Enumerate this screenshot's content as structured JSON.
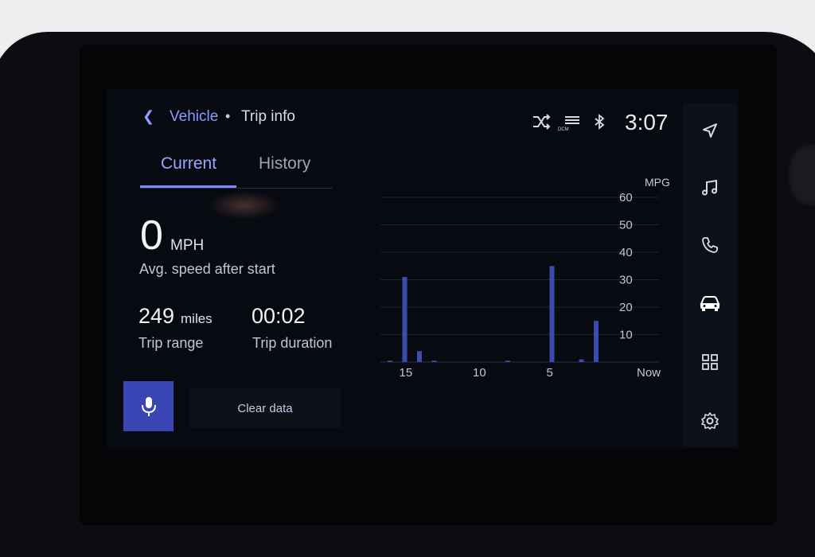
{
  "header": {
    "back_icon": "chevron-left-icon",
    "breadcrumb_parent": "Vehicle",
    "breadcrumb_sep": "•",
    "breadcrumb_current": "Trip info"
  },
  "status": {
    "icons": [
      "shuffle-off-icon",
      "dcm-icon",
      "bluetooth-icon"
    ],
    "dcm_label": "DCM",
    "time": "3:07"
  },
  "tabs": [
    {
      "label": "Current",
      "active": true
    },
    {
      "label": "History",
      "active": false
    }
  ],
  "metrics": {
    "speed_value": "0",
    "speed_unit": "MPH",
    "speed_label": "Avg. speed after start",
    "range_value": "249",
    "range_unit": "miles",
    "range_label": "Trip range",
    "duration_value": "00:02",
    "duration_label": "Trip duration"
  },
  "actions": {
    "voice_icon": "microphone-icon",
    "clear_label": "Clear data"
  },
  "side_nav": [
    {
      "name": "navigation-icon"
    },
    {
      "name": "music-icon"
    },
    {
      "name": "phone-icon"
    },
    {
      "name": "car-icon",
      "active": true
    },
    {
      "name": "apps-grid-icon"
    },
    {
      "name": "settings-icon"
    }
  ],
  "colors": {
    "accent": "#7f8cff",
    "bar": "#4456c8",
    "mic_button": "#3a46b4"
  },
  "chart_data": {
    "type": "bar",
    "ylabel": "MPG",
    "ylim": [
      0,
      60
    ],
    "yticks": [
      "60",
      "50",
      "40",
      "30",
      "20",
      "10"
    ],
    "xticks": [
      "15",
      "10",
      "5",
      "Now"
    ],
    "x": [
      16,
      15,
      14,
      13,
      8,
      5,
      3,
      2
    ],
    "values": [
      0.5,
      31,
      4,
      0.5,
      0.5,
      35,
      1,
      15
    ]
  }
}
